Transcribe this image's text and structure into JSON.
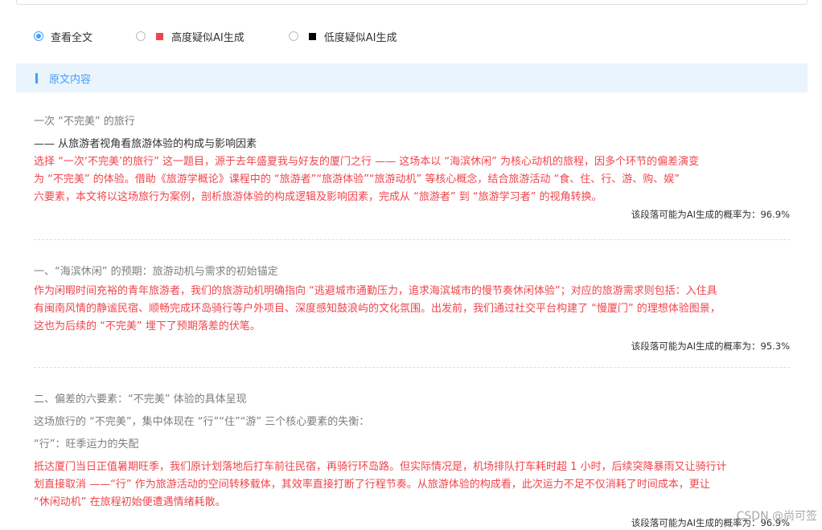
{
  "filter": {
    "options": [
      {
        "label": "查看全文",
        "checked": true
      },
      {
        "label": "高度疑似AI生成",
        "checked": false,
        "color": "#f0444b"
      },
      {
        "label": "低度疑似AI生成",
        "checked": false,
        "color": "#000000"
      }
    ]
  },
  "section": {
    "title": "原文内容"
  },
  "blocks": [
    {
      "lines": [
        {
          "text": "一次 “不完美” 的旅行",
          "style": "grey"
        },
        {
          "text": "—— 从旅游者视角看旅游体验的构成与影响因素",
          "style": "dark"
        },
        {
          "text": "选择 “一次‘不完美’的旅行” 这一题目，源于去年盛夏我与好友的厦门之行 —— 这场本以 “海滨休闲” 为核心动机的旅程，因多个环节的偏差演变",
          "style": "red"
        },
        {
          "text": "为 “不完美” 的体验。借助《旅游学概论》课程中的 “旅游者”“旅游体验”“旅游动机” 等核心概念，结合旅游活动 “食、住、行、游、购、娱”",
          "style": "red"
        },
        {
          "text": "六要素，本文将以这场旅行为案例，剖析旅游体验的构成逻辑及影响因素，完成从 “旅游者” 到 “旅游学习者” 的视角转换。",
          "style": "red"
        }
      ],
      "probability": "该段落可能为AI生成的概率为：96.9%"
    },
    {
      "lines": [
        {
          "text": "一、“海滨休闲” 的预期：旅游动机与需求的初始锚定",
          "style": "grey"
        },
        {
          "text": "作为闲暇时间充裕的青年旅游者，我们的旅游动机明确指向 “逃避城市通勤压力，追求海滨城市的慢节奏休闲体验”；对应的旅游需求则包括：入住具",
          "style": "red"
        },
        {
          "text": "有闽南风情的静谧民宿、顺畅完成环岛骑行等户外项目、深度感知鼓浪屿的文化氛围。出发前，我们通过社交平台构建了 “慢厦门” 的理想体验图景，",
          "style": "red"
        },
        {
          "text": "这也为后续的 “不完美” 埋下了预期落差的伏笔。",
          "style": "red"
        }
      ],
      "probability": "该段落可能为AI生成的概率为：95.3%"
    },
    {
      "lines": [
        {
          "text": "二、偏差的六要素：“不完美” 体验的具体呈现",
          "style": "grey"
        },
        {
          "text": "这场旅行的 “不完美”，集中体现在 “行”“住”“游” 三个核心要素的失衡：",
          "style": "grey"
        },
        {
          "text": "“行”：旺季运力的失配",
          "style": "grey"
        },
        {
          "text": "抵达厦门当日正值暑期旺季，我们原计划落地后打车前往民宿，再骑行环岛路。但实际情况是，机场排队打车耗时超 1 小时，后续突降暴雨又让骑行计",
          "style": "red"
        },
        {
          "text": "划直接取消 ——“行” 作为旅游活动的空间转移载体，其效率直接打断了行程节奏。从旅游体验的构成看，此次运力不足不仅消耗了时间成本，更让",
          "style": "red"
        },
        {
          "text": "“休闲动机” 在旅程初始便遭遇情绪耗散。",
          "style": "red"
        }
      ],
      "probability": "该段落可能为AI生成的概率为：96.9%"
    }
  ],
  "watermark": "CSDN @尚可签"
}
